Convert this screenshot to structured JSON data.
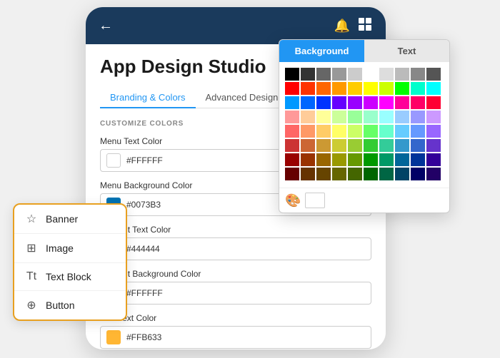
{
  "phone": {
    "header": {
      "back_label": "←",
      "bell_label": "🔔",
      "apps_label": "⊞"
    },
    "title": "App Design Studio",
    "tabs": [
      {
        "label": "Branding & Colors",
        "active": true
      },
      {
        "label": "Advanced Designer",
        "active": false
      }
    ],
    "section_label": "CUSTOMIZE COLORS",
    "colors": [
      {
        "label": "Menu Text Color",
        "hex": "#FFFFFF",
        "swatch": "#FFFFFF",
        "border": "1px solid #ccc"
      },
      {
        "label": "Menu Background Color",
        "hex": "#0073B3",
        "swatch": "#0073B3",
        "border": "none"
      },
      {
        "label": "Content Text Color",
        "hex": "#444444",
        "swatch": "#444444",
        "border": "none"
      },
      {
        "label": "Content Background Color",
        "hex": "#FFFFFF",
        "swatch": "#FFFFFF",
        "border": "1px solid #ccc"
      },
      {
        "label": "Link Text Color",
        "hex": "#FFB633",
        "swatch": "#FFB633",
        "border": "none"
      }
    ]
  },
  "color_picker": {
    "tabs": [
      {
        "label": "Background",
        "active": true
      },
      {
        "label": "Text",
        "active": false
      }
    ],
    "grid": [
      [
        "#000000",
        "#333333",
        "#666666",
        "#999999",
        "#cccccc",
        "#ffffff",
        "#dddddd",
        "#bbbbbb",
        "#888888",
        "#555555"
      ],
      [
        "#ff0000",
        "#ff3300",
        "#ff6600",
        "#ff9900",
        "#ffcc00",
        "#ffff00",
        "#ccff00",
        "#00ff00",
        "#00ffcc",
        "#00ffff"
      ],
      [
        "#0099ff",
        "#0066ff",
        "#0033ff",
        "#6600ff",
        "#9900ff",
        "#cc00ff",
        "#ff00ff",
        "#ff0099",
        "#ff0066",
        "#ff0033"
      ],
      [
        "#ff9999",
        "#ffcc99",
        "#ffff99",
        "#ccff99",
        "#99ff99",
        "#99ffcc",
        "#99ffff",
        "#99ccff",
        "#9999ff",
        "#cc99ff"
      ],
      [
        "#ff6666",
        "#ff9966",
        "#ffcc66",
        "#ffff66",
        "#ccff66",
        "#66ff66",
        "#66ffcc",
        "#66ccff",
        "#6699ff",
        "#9966ff"
      ],
      [
        "#cc3333",
        "#cc6633",
        "#cc9933",
        "#cccc33",
        "#99cc33",
        "#33cc33",
        "#33cc99",
        "#3399cc",
        "#3366cc",
        "#6633cc"
      ],
      [
        "#990000",
        "#993300",
        "#996600",
        "#999900",
        "#669900",
        "#009900",
        "#009966",
        "#006699",
        "#003399",
        "#330099"
      ],
      [
        "#660000",
        "#663300",
        "#664400",
        "#666600",
        "#446600",
        "#006600",
        "#006644",
        "#004466",
        "#000066",
        "#220066"
      ]
    ]
  },
  "widget_panel": {
    "items": [
      {
        "icon": "☆",
        "label": "Banner"
      },
      {
        "icon": "⊞",
        "label": "Image"
      },
      {
        "icon": "T↕",
        "label": "Text Block"
      },
      {
        "icon": "⊕",
        "label": "Button"
      }
    ]
  }
}
